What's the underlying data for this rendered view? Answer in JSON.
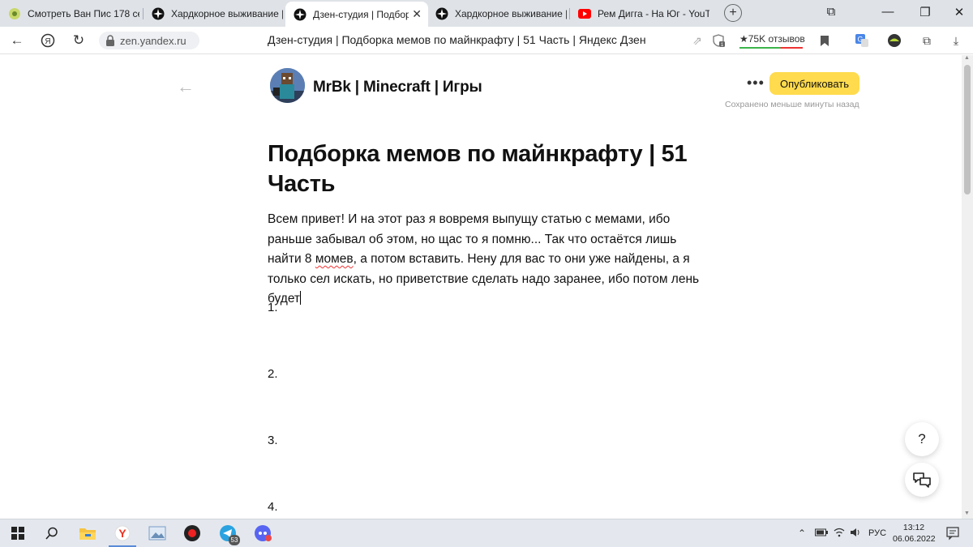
{
  "browser": {
    "tabs": [
      {
        "label": "Смотреть Ван Пис 178 сер",
        "icon": "anime-icon"
      },
      {
        "label": "Хардкорное выживание |",
        "icon": "zen-icon"
      },
      {
        "label": "Дзен-студия | Подборк",
        "icon": "zen-icon",
        "active": true
      },
      {
        "label": "Хардкорное выживание |",
        "icon": "zen-icon"
      },
      {
        "label": "Рем Дигга - На Юг - YouTu",
        "icon": "youtube-icon"
      }
    ],
    "url": "zen.yandex.ru",
    "page_title": "Дзен-студия | Подборка мемов по майнкрафту | 51 Часть | Яндекс Дзен",
    "reviews": "★75K отзывов"
  },
  "editor": {
    "channel_name": "MrBk | Minecraft | Игры",
    "publish_label": "Опубликовать",
    "saved_status": "Сохранено меньше минуты назад",
    "title": "Подборка мемов по майнкрафту | 51 Часть",
    "body_before": "Всем привет! И на этот раз я вовремя выпущу статью с мемами, ибо раньше забывал об этом, но щас то я помню... Так что остаётся лишь найти 8 ",
    "body_misspelled": "момев",
    "body_after": ", а потом вставить. Нену для вас то они уже найдены, а я только сел искать, но приветствие сделать надо заранее, ибо потом лень будет",
    "list_items": [
      "1.",
      "2.",
      "3.",
      "4."
    ],
    "help_label": "?"
  },
  "taskbar": {
    "telegram_badge": "53",
    "lang": "РУС",
    "time": "13:12",
    "date": "06.06.2022"
  }
}
